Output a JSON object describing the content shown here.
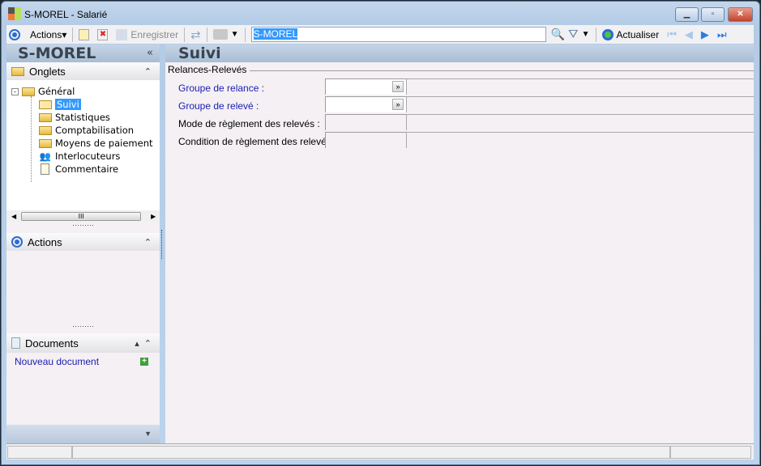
{
  "window": {
    "title": "S-MOREL -  Salarié",
    "controls": [
      "minimize",
      "maximize",
      "close"
    ]
  },
  "toolbar": {
    "actions": "Actions",
    "save": "Enregistrer",
    "search_value": "S-MOREL",
    "refresh": "Actualiser"
  },
  "left": {
    "title": "S-MOREL",
    "tabs_header": "Onglets",
    "tree": {
      "root": "Général",
      "items": [
        "Suivi",
        "Statistiques",
        "Comptabilisation",
        "Moyens de paiement",
        "Interlocuteurs",
        "Commentaire"
      ],
      "selected": "Suivi"
    },
    "actions_header": "Actions",
    "documents_header": "Documents",
    "new_document": "Nouveau document"
  },
  "main": {
    "title": "Suivi",
    "group": "Relances-Relevés",
    "fields": [
      {
        "label": "Groupe de relance :",
        "value": ""
      },
      {
        "label": "Groupe de relevé :",
        "value": ""
      },
      {
        "label": "Mode de règlement des relevés :",
        "value": ""
      },
      {
        "label": "Condition de règlement des relevés :",
        "value": ""
      }
    ]
  }
}
